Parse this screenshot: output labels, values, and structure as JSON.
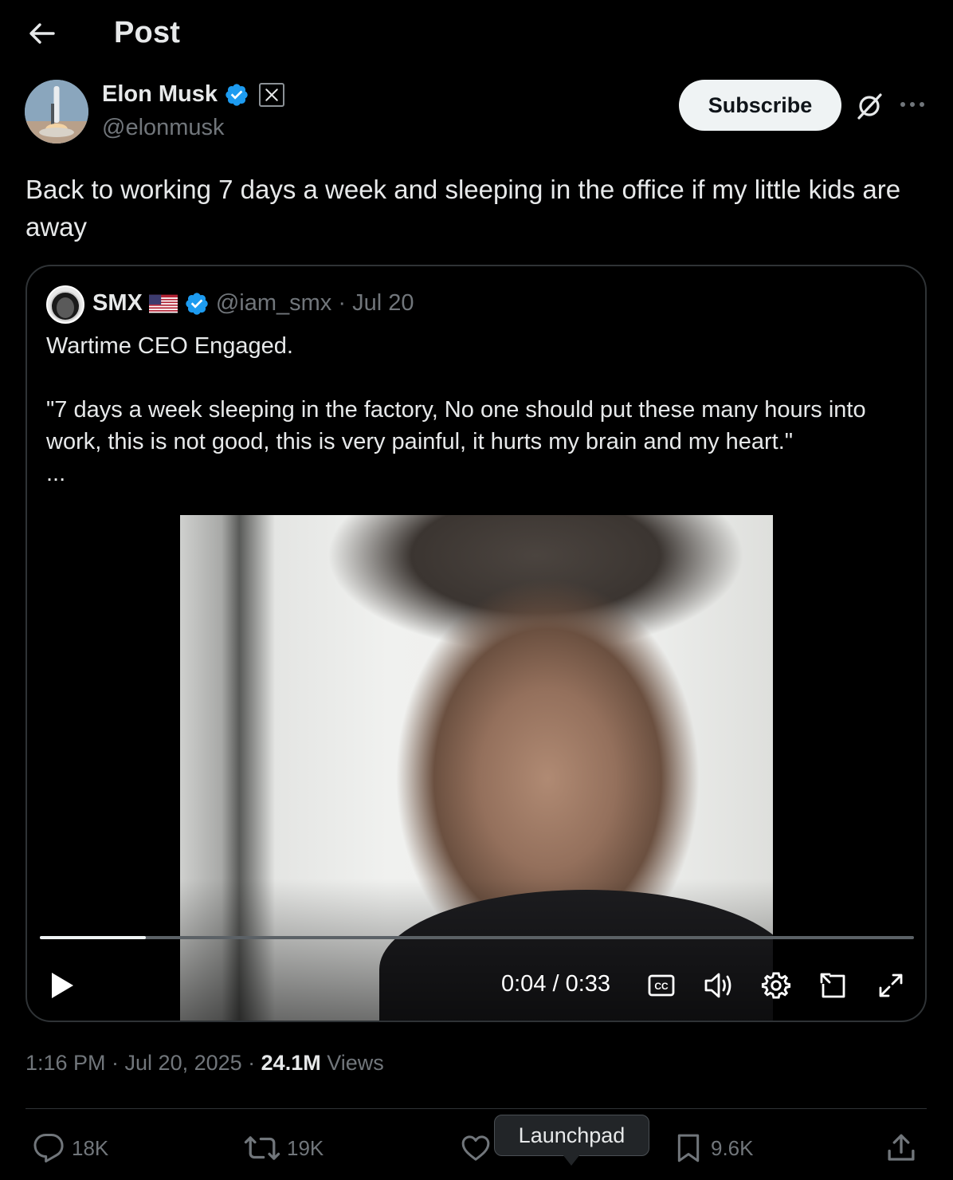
{
  "header": {
    "title": "Post",
    "back_icon": "arrow-left-icon"
  },
  "author": {
    "name": "Elon Musk",
    "handle": "@elonmusk",
    "verified": true,
    "verified_color": "#1d9bf0",
    "affiliation_badge": "x-logo-icon"
  },
  "actions_top": {
    "subscribe_label": "Subscribe",
    "grok_icon": "grok-icon",
    "more_icon": "more-icon"
  },
  "post": {
    "text": "Back to working 7 days a week and sleeping in the office if my little kids are away"
  },
  "quote": {
    "name": "SMX",
    "flag": "us-flag-icon",
    "verified": true,
    "handle_date": "@iam_smx · Jul 20",
    "lines": [
      "Wartime CEO Engaged.",
      "\"7 days a week sleeping in the factory, No one should put these many hours into work, this is not good, this is very painful, it hurts my brain and my heart.\"",
      "..."
    ],
    "video": {
      "time": "0:04 / 0:33",
      "progress": 0.121,
      "controls": [
        "play-icon",
        "closed-captions-icon",
        "volume-icon",
        "settings-icon",
        "picture-in-picture-icon",
        "fullscreen-icon"
      ]
    }
  },
  "meta": {
    "timestamp": "1:16 PM · Jul 20, 2025 · ",
    "views_count": "24.1M",
    "views_label": " Views"
  },
  "engagement": {
    "replies": "18K",
    "reposts": "19K",
    "bookmarks": "9.6K"
  },
  "tooltip": {
    "text": "Launchpad"
  },
  "colors": {
    "background": "#000000",
    "text_primary": "#e7e9ea",
    "text_secondary": "#71767b",
    "border": "#2f3336",
    "accent": "#1d9bf0"
  }
}
